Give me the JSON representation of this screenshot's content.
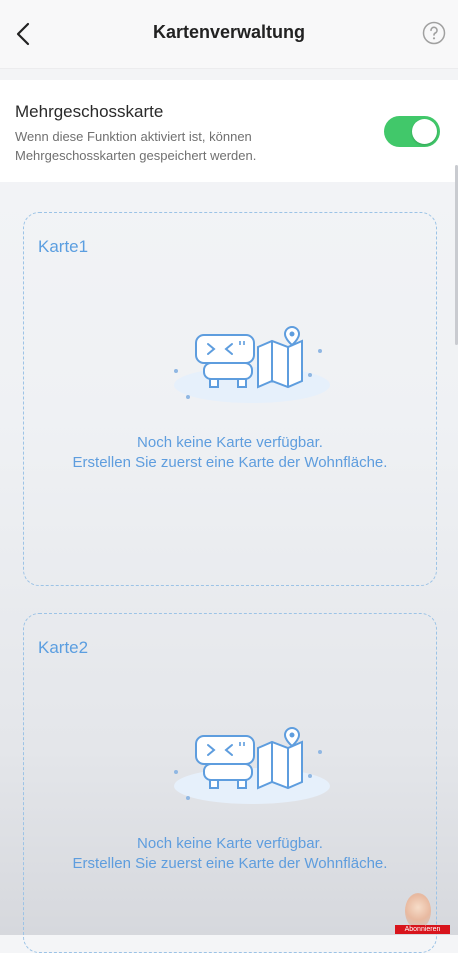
{
  "header": {
    "title": "Kartenverwaltung"
  },
  "multifloor": {
    "title": "Mehrgeschosskarte",
    "description": "Wenn diese Funktion aktiviert ist, können Mehrgeschosskarten gespeichert werden.",
    "enabled": true,
    "toggle_color": "#41c86a"
  },
  "cards": [
    {
      "label": "Karte1",
      "message_line1": "Noch keine Karte verfügbar.",
      "message_line2": "Erstellen Sie zuerst eine Karte der Wohnfläche."
    },
    {
      "label": "Karte2",
      "message_line1": "Noch keine Karte verfügbar.",
      "message_line2": "Erstellen Sie zuerst eine Karte der Wohnfläche."
    }
  ],
  "overlay": {
    "subscribe_label": "Abonnieren"
  }
}
